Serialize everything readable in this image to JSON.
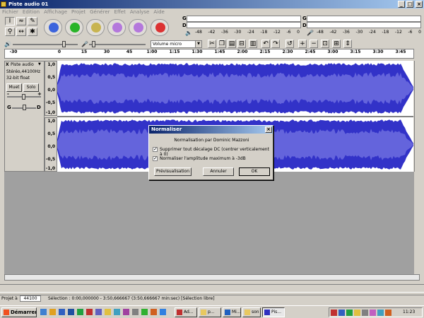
{
  "window": {
    "title": "Piste audio 01",
    "min_label": "_",
    "max_label": "□",
    "close_label": "×"
  },
  "menu": [
    "Fichier",
    "Edition",
    "Affichage",
    "Projet",
    "Générer",
    "Effet",
    "Analyse",
    "Aide"
  ],
  "meters": {
    "channel_labels": [
      "G",
      "D",
      "G",
      "D"
    ],
    "scale_ticks": [
      "-48",
      "-42",
      "-36",
      "-30",
      "-24",
      "-18",
      "-12",
      "-6",
      "0"
    ]
  },
  "mixer": {
    "input_source": "Volume micro"
  },
  "ruler": {
    "ticks": [
      "-30",
      "0",
      "15",
      "30",
      "45",
      "1:00",
      "1:15",
      "1:30",
      "1:45",
      "2:00",
      "2:15",
      "2:30",
      "2:45",
      "3:00",
      "3:15",
      "3:30",
      "3:45"
    ]
  },
  "track": {
    "name": "Piste audio",
    "info1": "Stéréo,44100Hz",
    "info2": "32-bit float",
    "mute": "Muet",
    "solo": "Solo",
    "gain_minus": "-",
    "gain_plus": "+",
    "pan_left": "G",
    "pan_right": "D",
    "close": "X",
    "scale": [
      "1,0",
      "0,5",
      "0,0",
      "-0,5",
      "-1,0"
    ],
    "wave_color": "#3232c8",
    "wave_light": "#6464dc"
  },
  "dialog": {
    "title": "Normaliser",
    "subtitle": "Normalisation par Dominic Mazzoni",
    "option1": "Supprimer tout décalage DC (centrer verticalement à 0)",
    "option2": "Normaliser l'amplitude maximum à -3dB",
    "preview": "Prévisualisation",
    "cancel": "Annuler",
    "ok": "OK",
    "close": "×"
  },
  "status": {
    "rate_label": "Projet à",
    "rate_value": "44100",
    "selection": "Sélection : 0:00,000000 - 3:50,666667 (3:50,666667 min:sec)  [Sélection libre]"
  },
  "taskbar": {
    "start": "Démarrer",
    "tasks": [
      "Ad...",
      "p...",
      "Mi...",
      "son",
      "Pis..."
    ],
    "clock": "11:23"
  }
}
